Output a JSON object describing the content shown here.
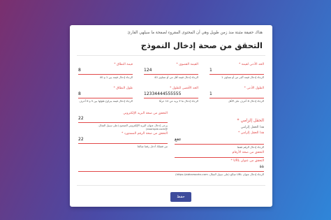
{
  "header": {
    "subtitle": "هناك حقيقة مثبتة منذ زمن طويل وهي أن المحتوى المقروء لصفحة ما سيلهي القارئ",
    "title": "التحقق من صحة إدخال النموذج"
  },
  "fields": {
    "min_length": {
      "label": "الحد الأدنى لقيمة *",
      "value": "1",
      "error": "الرجاء إدخال قيمة أكبر من أو تساوي 1"
    },
    "max_value": {
      "label": "القيمة القصوى *",
      "value": "124",
      "error": "الرجاء إدخال قيمة أقل من أو تساوي 40"
    },
    "range": {
      "label": "قيمة النطاق *",
      "value": "8",
      "error": "الرجاء إدخال قيمة بين 1 و 40"
    },
    "min_length_chars": {
      "label": "الطول الأدنى *",
      "value": "1",
      "error": "الرجاء إدخال 8 أحرف على الأقل"
    },
    "max_length": {
      "label": "الحد الأقصى للطول *",
      "value": "12334444555555",
      "error": "الرجاء إدخال ما لا يزيد عن 10 حرفًا"
    },
    "range_length": {
      "label": "طول النطاق *",
      "value": "8",
      "error": "الرجاء إدخال قيمة يتراوح طولها بين 5 و 6 أحرف"
    },
    "email": {
      "label": "التحقق من صحة البريد الإلكتروني",
      "value": "22",
      "error": "يرجى إدخال عنوان البريد الإلكتروني الصحيح"
    },
    "number": {
      "label": "التحقق من صحة الرقم المستورد *",
      "value": "22",
      "error": "من فضلك أدخل رقما صالحا"
    },
    "required": {
      "label": "هذا الحقل إلزامي *",
      "value": "ععع",
      "error": "الرجاء إدخال الرقم فقط"
    },
    "digits": {
      "label": "التحقق من صحة الأرقام",
      "value": "",
      "error": ""
    },
    "url": {
      "label": "التحقق من عنوان URL *",
      "value": "ةة",
      "error": "الرجاء إدخال عنوان URL صالح (على سبيل المثال، https://abharworks.com)"
    }
  },
  "section": {
    "required_title": "الحقل إلزامي *",
    "required_hint": "هذا الحقل إلزامي"
  },
  "notes": {
    "email_hint": "يرجى إدخال عنوان البريد الإلكتروني الصحيح (على سبيل المثال، @example.com)"
  },
  "actions": {
    "save_label": "حفظ"
  },
  "colors": {
    "accent": "#e24848",
    "button": "#3e4c9c"
  }
}
